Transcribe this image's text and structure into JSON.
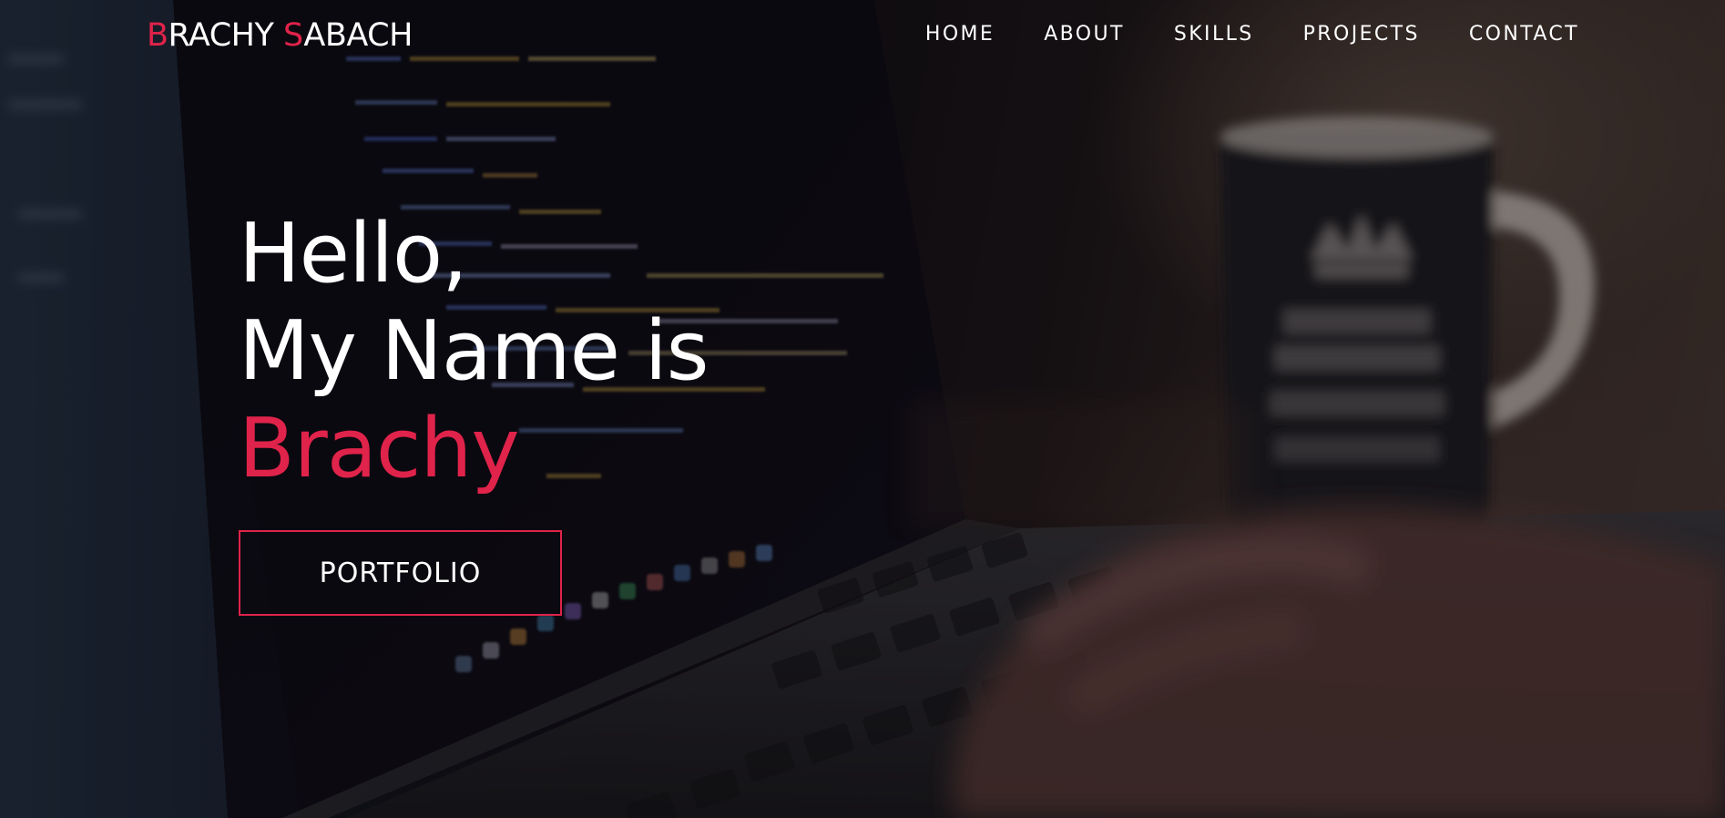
{
  "brand": {
    "first_initial": "B",
    "first_rest": "RACHY ",
    "last_initial": "S",
    "last_rest": "ABACH"
  },
  "nav": {
    "items": [
      {
        "label": "HOME"
      },
      {
        "label": "ABOUT"
      },
      {
        "label": "SKILLS"
      },
      {
        "label": "PROJECTS"
      },
      {
        "label": "CONTACT"
      }
    ]
  },
  "hero": {
    "greeting": "Hello,",
    "intro": "My Name is",
    "name": "Brachy",
    "cta_label": "PORTFOLIO"
  },
  "colors": {
    "accent": "#e0234a",
    "text": "#ffffff",
    "background": "#0c0a10"
  },
  "background_image": {
    "description_icon": "laptop-code-photo"
  }
}
